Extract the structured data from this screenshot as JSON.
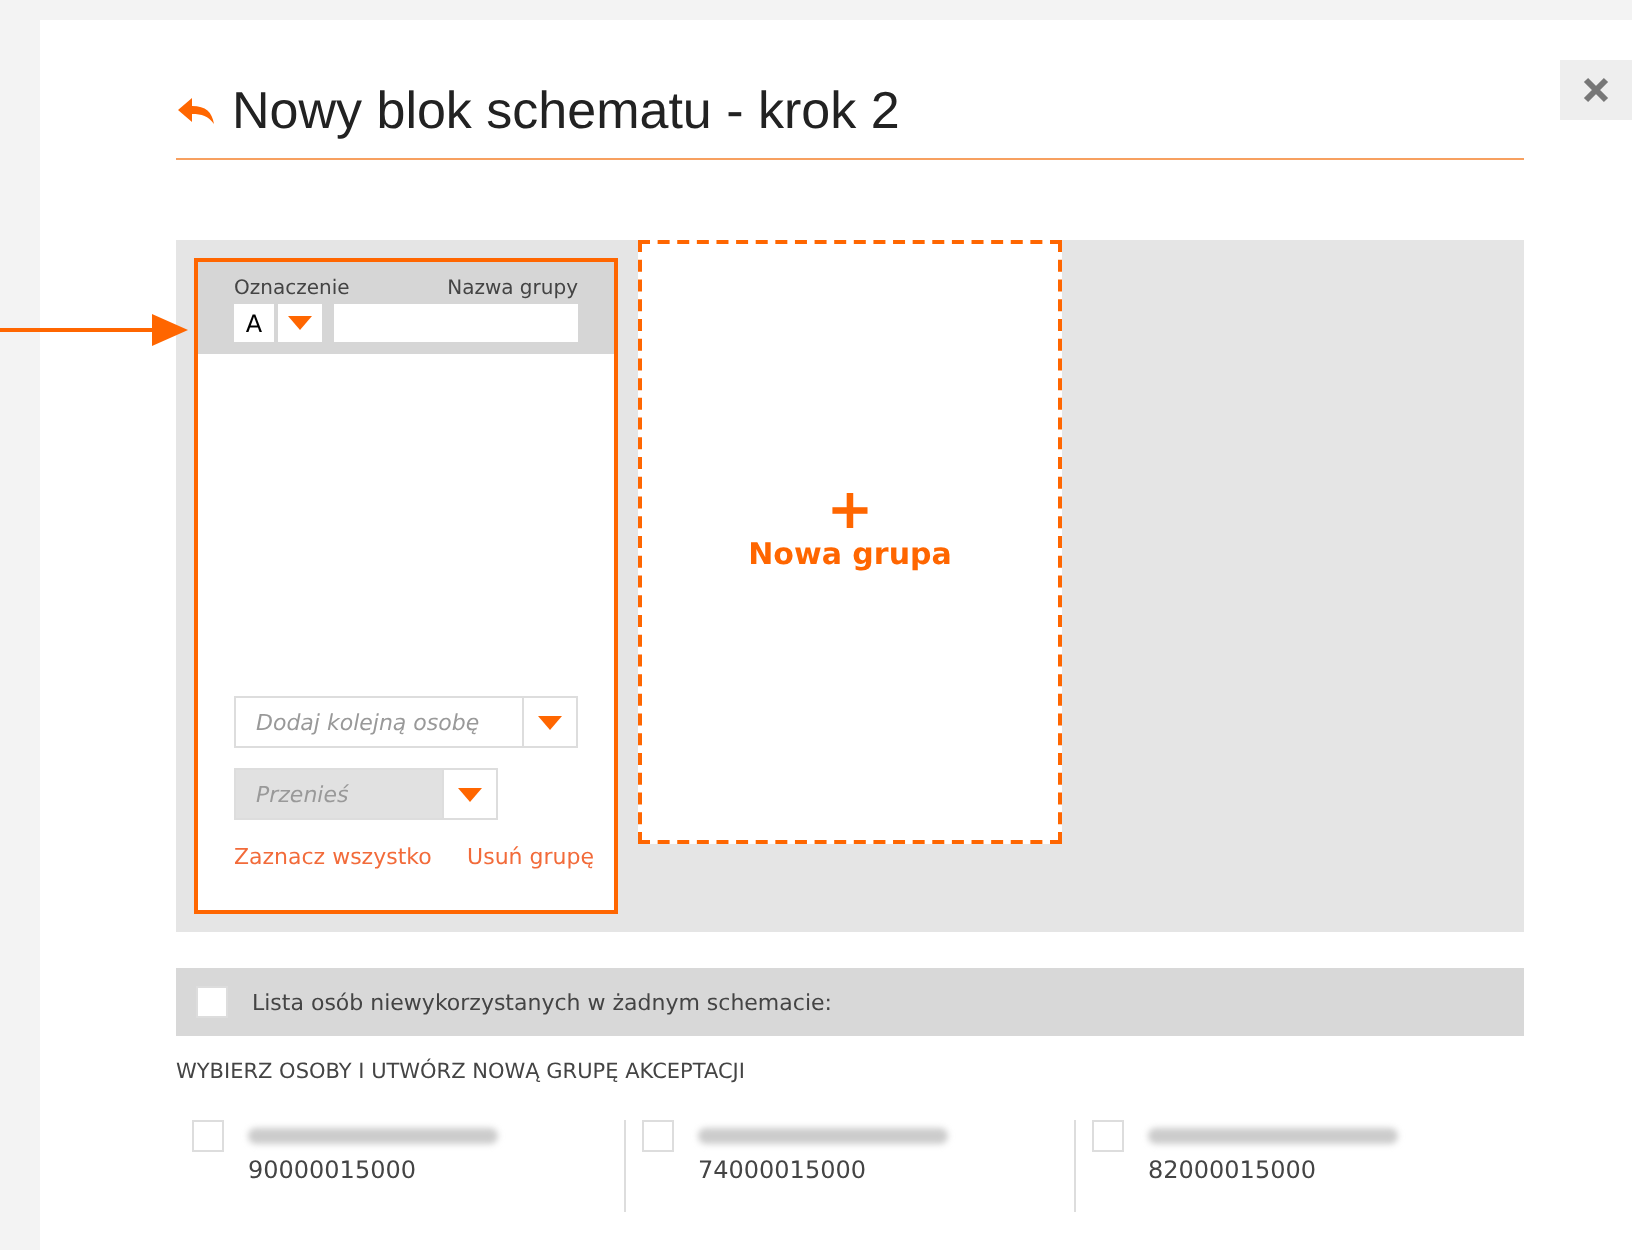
{
  "dialog": {
    "title": "Nowy blok schematu - krok 2"
  },
  "groups": [
    {
      "designation_label": "Oznaczenie",
      "designation": "A",
      "name_label": "Nazwa grupy",
      "add_person_placeholder": "Dodaj kolejną osobę",
      "move_placeholder": "Przenieś",
      "move_disabled": true,
      "select_all": "Zaznacz wszystko",
      "delete": "Usuń grupę",
      "highlighted": true
    }
  ],
  "new_group": {
    "label": "Nowa grupa",
    "icon": "+"
  },
  "unused": {
    "label": "Lista osób niewykorzystanych w żadnym schemacie:",
    "checked": false,
    "instruction": "WYBIERZ OSOBY I UTWÓRZ NOWĄ GRUPĘ AKCEPTACJI"
  },
  "people": [
    {
      "number": "90000015000",
      "checked": false
    },
    {
      "number": "74000015000",
      "checked": false
    },
    {
      "number": "82000015000",
      "checked": false
    }
  ]
}
